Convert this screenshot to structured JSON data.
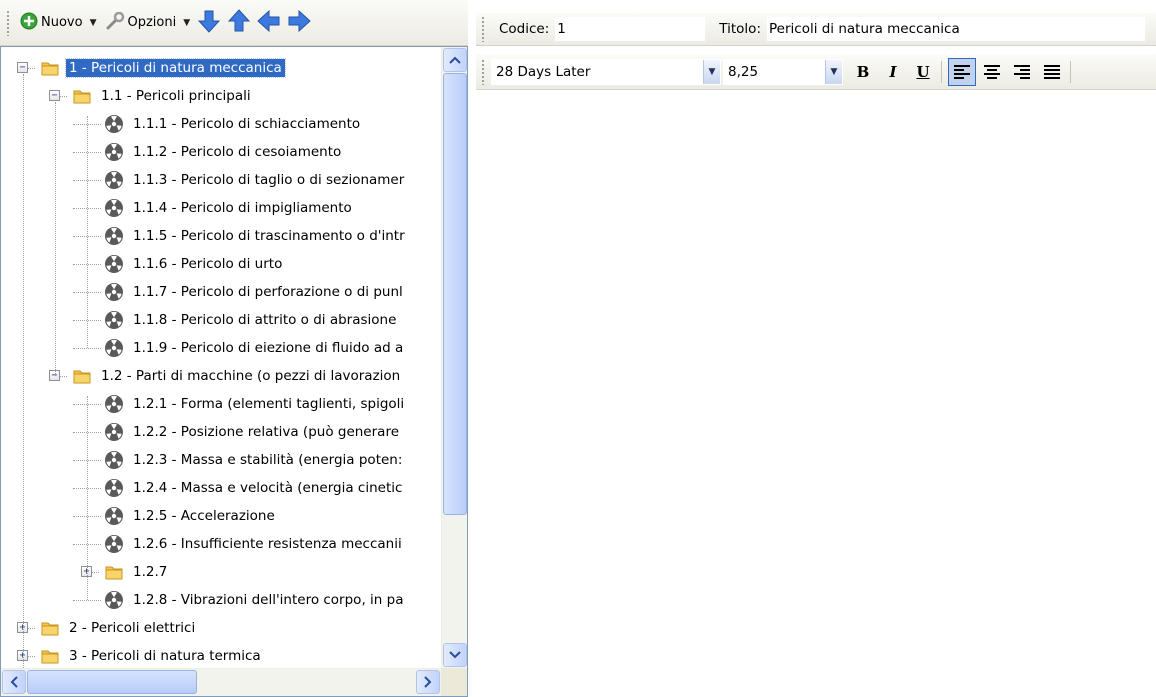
{
  "toolbar": {
    "new_label": "Nuovo",
    "options_label": "Opzioni",
    "move_down": "arrow-down-icon",
    "move_up": "arrow-up-icon",
    "move_left": "arrow-left-icon",
    "move_right": "arrow-right-icon"
  },
  "tree": {
    "selected": "1 - Pericoli di natura meccanica",
    "rows": [
      {
        "label": "1 - Pericoli di natura meccanica",
        "kind": "folder",
        "level": 0,
        "expanded": true
      },
      {
        "label": "1.1 - Pericoli principali",
        "kind": "folder",
        "level": 1,
        "expanded": true
      },
      {
        "label": "1.1.1 - Pericolo di schiacciamento",
        "kind": "hazard",
        "level": 2
      },
      {
        "label": "1.1.2 - Pericolo di cesoiamento",
        "kind": "hazard",
        "level": 2
      },
      {
        "label": "1.1.3 - Pericolo di taglio o di sezionamer",
        "kind": "hazard",
        "level": 2
      },
      {
        "label": "1.1.4 - Pericolo di impigliamento",
        "kind": "hazard",
        "level": 2
      },
      {
        "label": "1.1.5 - Pericolo di trascinamento o d'intr",
        "kind": "hazard",
        "level": 2
      },
      {
        "label": "1.1.6 - Pericolo di urto",
        "kind": "hazard",
        "level": 2
      },
      {
        "label": "1.1.7 - Pericolo di perforazione o di punl",
        "kind": "hazard",
        "level": 2
      },
      {
        "label": "1.1.8 - Pericolo di attrito o di abrasione",
        "kind": "hazard",
        "level": 2
      },
      {
        "label": "1.1.9 - Pericolo di eiezione di fluido ad a",
        "kind": "hazard",
        "level": 2
      },
      {
        "label": "1.2 - Parti di macchine (o pezzi di lavorazion",
        "kind": "folder",
        "level": 1,
        "expanded": true
      },
      {
        "label": "1.2.1 - Forma (elementi taglienti, spigoli",
        "kind": "hazard",
        "level": 2
      },
      {
        "label": "1.2.2 - Posizione relativa (può generare",
        "kind": "hazard",
        "level": 2
      },
      {
        "label": "1.2.3 - Massa e stabilità (energia poten:",
        "kind": "hazard",
        "level": 2
      },
      {
        "label": "1.2.4 - Massa e velocità (energia cinetic",
        "kind": "hazard",
        "level": 2
      },
      {
        "label": "1.2.5 - Accelerazione",
        "kind": "hazard",
        "level": 2
      },
      {
        "label": "1.2.6 - Insufficiente resistenza meccanii",
        "kind": "hazard",
        "level": 2
      },
      {
        "label": "1.2.7",
        "kind": "folder",
        "level": 2,
        "expanded": false
      },
      {
        "label": "1.2.8 - Vibrazioni dell'intero corpo, in pa",
        "kind": "hazard",
        "level": 2
      },
      {
        "label": "2 - Pericoli elettrici",
        "kind": "folder",
        "level": 0,
        "expanded": false
      },
      {
        "label": "3 - Pericoli di natura termica",
        "kind": "folder",
        "level": 0,
        "expanded": false
      }
    ]
  },
  "editor": {
    "codice_label": "Codice:",
    "codice_value": "1",
    "titolo_label": "Titolo:",
    "titolo_value": "Pericoli di natura meccanica",
    "font_name": "28 Days Later",
    "font_size": "8,25",
    "bold_label": "B",
    "italic_label": "I",
    "underline_label": "U",
    "alignment_active": "left"
  },
  "colors": {
    "selection": "#316ac5",
    "folder": "#f3c34a",
    "hazard_icon": "#555555",
    "arrow": "#3d7ae0",
    "new_icon": "#3aa53a"
  }
}
